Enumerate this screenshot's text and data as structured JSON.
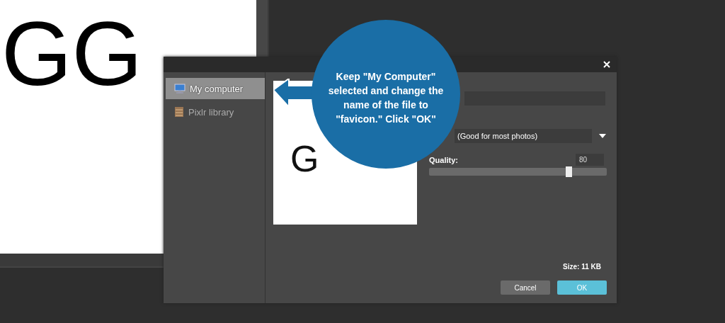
{
  "canvas": {
    "text": "GG"
  },
  "dialog": {
    "sidebar": {
      "items": [
        {
          "label": "My computer",
          "selected": true,
          "kind": "computer"
        },
        {
          "label": "Pixlr library",
          "selected": false,
          "kind": "library"
        }
      ]
    },
    "preview": {
      "text": "G"
    },
    "format": {
      "value": "(Good for most photos)"
    },
    "quality": {
      "label": "Quality:",
      "value": "80",
      "level": 0.79
    },
    "size": "Size: 11 KB",
    "buttons": [
      {
        "label": "Cancel",
        "kind": "secondary"
      },
      {
        "label": "OK",
        "kind": "primary"
      }
    ]
  },
  "callout": {
    "text": "Keep \"My Computer\" selected and change the name of the file to \"favicon.\" Click \"OK\""
  }
}
